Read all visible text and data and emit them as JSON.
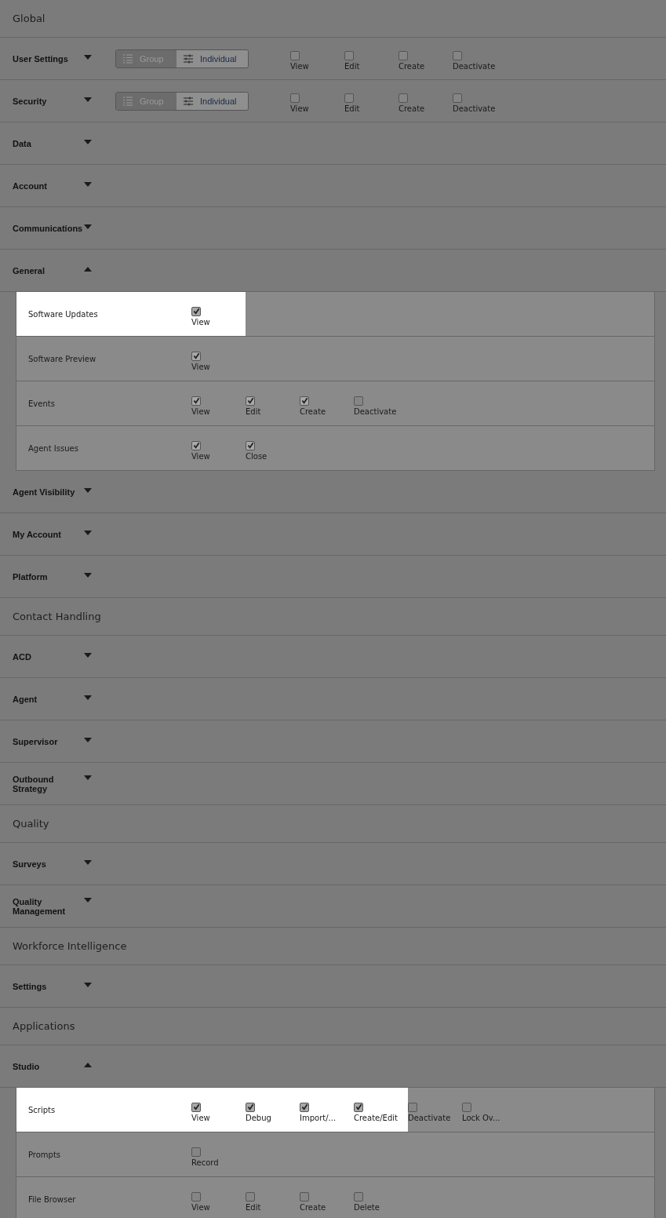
{
  "sections": [
    {
      "kind": "heading",
      "title": "Global"
    },
    {
      "kind": "category",
      "label": "User Settings",
      "expanded": false,
      "toggle": [
        {
          "label": "Group",
          "selected": false
        },
        {
          "label": "Individual",
          "selected": true
        }
      ],
      "permissions": [
        {
          "label": "View",
          "checked": false
        },
        {
          "label": "Edit",
          "checked": false
        },
        {
          "label": "Create",
          "checked": false
        },
        {
          "label": "Deactivate",
          "checked": false
        }
      ]
    },
    {
      "kind": "category",
      "label": "Security",
      "expanded": false,
      "toggle": [
        {
          "label": "Group",
          "selected": false
        },
        {
          "label": "Individual",
          "selected": true
        }
      ],
      "permissions": [
        {
          "label": "View",
          "checked": false
        },
        {
          "label": "Edit",
          "checked": false
        },
        {
          "label": "Create",
          "checked": false
        },
        {
          "label": "Deactivate",
          "checked": false
        }
      ]
    },
    {
      "kind": "category",
      "label": "Data",
      "expanded": false
    },
    {
      "kind": "category",
      "label": "Account",
      "expanded": false
    },
    {
      "kind": "category",
      "label": "Communications",
      "expanded": false
    },
    {
      "kind": "category",
      "label": "General",
      "expanded": true,
      "children": [
        {
          "label": "Software Updates",
          "highlighted": true,
          "permissions": [
            {
              "label": "View",
              "checked": true,
              "highlighted": true
            }
          ]
        },
        {
          "label": "Software Preview",
          "highlighted": false,
          "permissions": [
            {
              "label": "View",
              "checked": true,
              "highlighted": false
            }
          ]
        },
        {
          "label": "Events",
          "highlighted": false,
          "permissions": [
            {
              "label": "View",
              "checked": true,
              "highlighted": false
            },
            {
              "label": "Edit",
              "checked": true,
              "highlighted": false
            },
            {
              "label": "Create",
              "checked": true,
              "highlighted": false
            },
            {
              "label": "Deactivate",
              "checked": false,
              "highlighted": false
            }
          ]
        },
        {
          "label": "Agent Issues",
          "highlighted": false,
          "permissions": [
            {
              "label": "View",
              "checked": true,
              "highlighted": false
            },
            {
              "label": "Close",
              "checked": true,
              "highlighted": false
            }
          ]
        }
      ]
    },
    {
      "kind": "category",
      "label": "Agent Visibility",
      "expanded": false
    },
    {
      "kind": "category",
      "label": "My Account",
      "expanded": false
    },
    {
      "kind": "category",
      "label": "Platform",
      "expanded": false
    },
    {
      "kind": "heading",
      "title": "Contact Handling"
    },
    {
      "kind": "category",
      "label": "ACD",
      "expanded": false
    },
    {
      "kind": "category",
      "label": "Agent",
      "expanded": false
    },
    {
      "kind": "category",
      "label": "Supervisor",
      "expanded": false
    },
    {
      "kind": "category",
      "label": "Outbound Strategy",
      "expanded": false
    },
    {
      "kind": "heading",
      "title": "Quality"
    },
    {
      "kind": "category",
      "label": "Surveys",
      "expanded": false
    },
    {
      "kind": "category",
      "label": "Quality Management",
      "expanded": false
    },
    {
      "kind": "heading",
      "title": "Workforce Intelligence"
    },
    {
      "kind": "category",
      "label": "Settings",
      "expanded": false
    },
    {
      "kind": "heading",
      "title": "Applications"
    },
    {
      "kind": "category",
      "label": "Studio",
      "expanded": true,
      "children": [
        {
          "label": "Scripts",
          "highlighted": true,
          "permissions": [
            {
              "label": "View",
              "checked": true,
              "highlighted": true
            },
            {
              "label": "Debug",
              "checked": true,
              "highlighted": true
            },
            {
              "label": "Import/...",
              "checked": true,
              "highlighted": true
            },
            {
              "label": "Create/Edit",
              "checked": true,
              "highlighted": true
            },
            {
              "label": "Deactivate",
              "checked": false,
              "highlighted": false
            },
            {
              "label": "Lock Ov...",
              "checked": false,
              "highlighted": false
            }
          ]
        },
        {
          "label": "Prompts",
          "highlighted": false,
          "permissions": [
            {
              "label": "Record",
              "checked": false,
              "highlighted": false
            }
          ]
        },
        {
          "label": "File Browser",
          "highlighted": false,
          "permissions": [
            {
              "label": "View",
              "checked": false,
              "highlighted": false
            },
            {
              "label": "Edit",
              "checked": false,
              "highlighted": false
            },
            {
              "label": "Create",
              "checked": false,
              "highlighted": false
            },
            {
              "label": "Delete",
              "checked": false,
              "highlighted": false
            }
          ]
        }
      ]
    }
  ]
}
